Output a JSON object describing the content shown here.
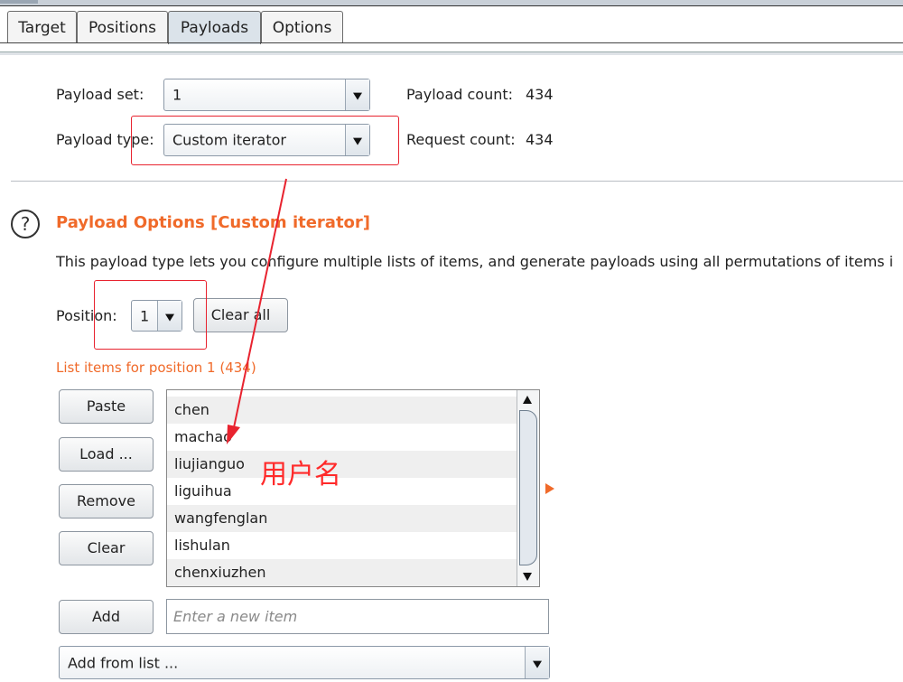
{
  "tabs": [
    "Target",
    "Positions",
    "Payloads",
    "Options"
  ],
  "active_tab": "Payloads",
  "payload_set": {
    "label": "Payload set:",
    "value": "1"
  },
  "payload_type": {
    "label": "Payload type:",
    "value": "Custom iterator"
  },
  "counts": {
    "payload_label": "Payload count:",
    "payload_value": "434",
    "request_label": "Request count:",
    "request_value": "434"
  },
  "section": {
    "title": "Payload Options [Custom iterator]",
    "description": "This payload type lets you configure multiple lists of items, and generate payloads using all permutations of items i"
  },
  "position": {
    "label": "Position:",
    "value": "1",
    "clear_all": "Clear all"
  },
  "list": {
    "header": "List items for position 1 (434)",
    "items": [
      "chen",
      "machao",
      "liujianguo",
      "liguihua",
      "wangfenglan",
      "lishulan",
      "chenxiuzhen"
    ],
    "buttons": {
      "paste": "Paste",
      "load": "Load ...",
      "remove": "Remove",
      "clear": "Clear"
    }
  },
  "add": {
    "label": "Add",
    "placeholder": "Enter a new item"
  },
  "add_from_list": "Add from list ...",
  "annotation": "用户名",
  "colors": {
    "accent": "#f06a2a",
    "annotation": "#ff2a2a",
    "active_tab": "#dbe3ea"
  }
}
